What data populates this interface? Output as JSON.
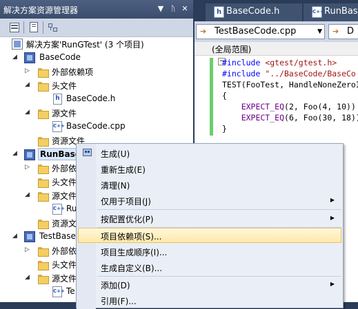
{
  "solution_explorer": {
    "title": "解决方案资源管理器",
    "pin_glyph": "▼",
    "autohide_glyph": "ᚢ",
    "close_glyph": "✕",
    "tree": [
      {
        "label": "解决方案'RunGTest' (3 个项目)",
        "arrow": ""
      },
      {
        "label": "BaseCode",
        "arrow": "◢"
      },
      {
        "label": "外部依赖项",
        "arrow": "▷"
      },
      {
        "label": "头文件",
        "arrow": "◢"
      },
      {
        "label": "BaseCode.h",
        "arrow": ""
      },
      {
        "label": "源文件",
        "arrow": "◢"
      },
      {
        "label": "BaseCode.cpp",
        "arrow": ""
      },
      {
        "label": "资源文件",
        "arrow": ""
      },
      {
        "label": "RunBase",
        "arrow": "◢"
      },
      {
        "label": "外部依",
        "arrow": "▷"
      },
      {
        "label": "头文件",
        "arrow": ""
      },
      {
        "label": "源文件",
        "arrow": "◢"
      },
      {
        "label": "Ru",
        "arrow": ""
      },
      {
        "label": "资源文",
        "arrow": ""
      },
      {
        "label": "TestBase",
        "arrow": "◢"
      },
      {
        "label": "外部依",
        "arrow": "▷"
      },
      {
        "label": "头文件",
        "arrow": ""
      },
      {
        "label": "源文件",
        "arrow": "◢"
      },
      {
        "label": "Te",
        "arrow": ""
      }
    ]
  },
  "editor": {
    "tabs": [
      {
        "label": "BaseCode.h",
        "icon": "h"
      },
      {
        "label": "RunBase",
        "icon": "C++"
      }
    ],
    "file_dropdown": "TestBaseCode.cpp",
    "member_dropdown": "D",
    "scope": "(全局范围)",
    "code": [
      {
        "a": "#include ",
        "b": "<gtest/gtest.h>"
      },
      {
        "a": "#include ",
        "b": "\"../BaseCode/BaseCo"
      },
      {
        "a": "TEST(FooTest, HandleNoneZeroI",
        "b": ""
      },
      {
        "a": "{",
        "b": ""
      },
      {
        "a": "    EXPECT_EQ",
        "b": "(2, Foo(4, 10))"
      },
      {
        "a": "    EXPECT_EQ",
        "b": "(6, Foo(30, 18))"
      },
      {
        "a": "}",
        "b": ""
      }
    ],
    "collapse_glyph": "−"
  },
  "context_menu": {
    "items": [
      {
        "label": "生成(U)",
        "submenu": false
      },
      {
        "label": "重新生成(E)",
        "submenu": false
      },
      {
        "label": "清理(N)",
        "submenu": false
      },
      {
        "label": "仅用于项目(J)",
        "submenu": true
      },
      {
        "label": "按配置优化(P)",
        "submenu": true
      },
      {
        "label": "项目依赖项(S)...",
        "submenu": false,
        "highlighted": true
      },
      {
        "label": "项目生成顺序(I)...",
        "submenu": false
      },
      {
        "label": "生成自定义(B)...",
        "submenu": false
      },
      {
        "label": "添加(D)",
        "submenu": true
      },
      {
        "label": "引用(F)...",
        "submenu": false
      }
    ],
    "submenu_glyph": "▶"
  },
  "colors": {
    "title_bar": "#4d6082",
    "background": "#2b3c59",
    "menu_highlight": "#ffe9a8",
    "change_bar": "#6ccf6a"
  }
}
